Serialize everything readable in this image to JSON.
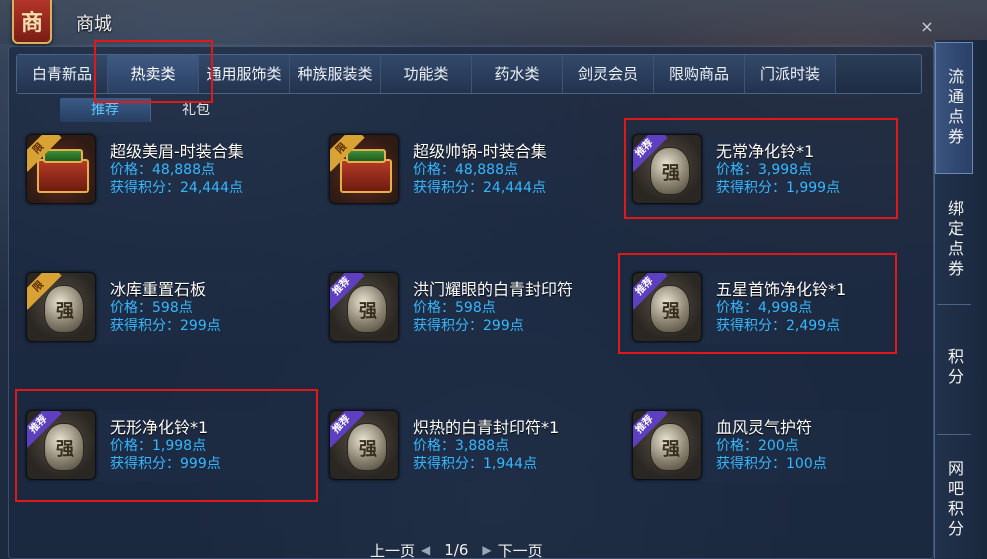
{
  "window": {
    "title": "商城",
    "logo_char": "商",
    "close": "×"
  },
  "tabs": [
    {
      "label": "白青新品",
      "active": false
    },
    {
      "label": "热卖类",
      "active": true
    },
    {
      "label": "通用服饰类",
      "active": false
    },
    {
      "label": "种族服装类",
      "active": false
    },
    {
      "label": "功能类",
      "active": false
    },
    {
      "label": "药水类",
      "active": false
    },
    {
      "label": "剑灵会员",
      "active": false
    },
    {
      "label": "限购商品",
      "active": false
    },
    {
      "label": "门派时装",
      "active": false
    }
  ],
  "subtabs": [
    {
      "label": "推荐",
      "active": true
    },
    {
      "label": "礼包",
      "active": false
    }
  ],
  "items": [
    {
      "name": "超级美眉-时装合集",
      "price": "价格：48,888点",
      "points": "获得积分：24,444点",
      "icon": "costume-chest-icon",
      "ribbon": "限"
    },
    {
      "name": "超级帅锅-时装合集",
      "price": "价格：48,888点",
      "points": "获得积分：24,444点",
      "icon": "costume-chest-icon",
      "ribbon": "限"
    },
    {
      "name": "无常净化铃*1",
      "price": "价格：3,998点",
      "points": "获得积分：1,999点",
      "icon": "rune-stone-icon",
      "ribbon": "推荐"
    },
    {
      "name": "冰库重置石板",
      "price": "价格：598点",
      "points": "获得积分：299点",
      "icon": "rune-stone-icon",
      "ribbon": "限"
    },
    {
      "name": "洪门耀眼的白青封印符",
      "price": "价格：598点",
      "points": "获得积分：299点",
      "icon": "rune-stone-icon",
      "ribbon": "推荐"
    },
    {
      "name": "五星首饰净化铃*1",
      "price": "价格：4,998点",
      "points": "获得积分：2,499点",
      "icon": "rune-stone-icon",
      "ribbon": "推荐"
    },
    {
      "name": "无形净化铃*1",
      "price": "价格：1,998点",
      "points": "获得积分：999点",
      "icon": "rune-stone-icon",
      "ribbon": "推荐"
    },
    {
      "name": "炽热的白青封印符*1",
      "price": "价格：3,888点",
      "points": "获得积分：1,944点",
      "icon": "rune-stone-icon",
      "ribbon": "推荐"
    },
    {
      "name": "血风灵气护符",
      "price": "价格：200点",
      "points": "获得积分：100点",
      "icon": "rune-stone-icon",
      "ribbon": "推荐"
    }
  ],
  "rune_char": "强",
  "side_tabs": [
    {
      "label": "流通点券",
      "active": true
    },
    {
      "label": "绑定点券",
      "active": false
    },
    {
      "label": "积分",
      "active": false
    },
    {
      "label": "网吧积分",
      "active": false
    }
  ],
  "pager": {
    "prev": "上一页",
    "page": "1/6",
    "next": "下一页",
    "prev_arrow": "◀",
    "next_arrow": "▶"
  },
  "colors": {
    "highlight": "#e01818",
    "price_text": "#35b8ff",
    "subtab_active": "#5fc6ff"
  }
}
